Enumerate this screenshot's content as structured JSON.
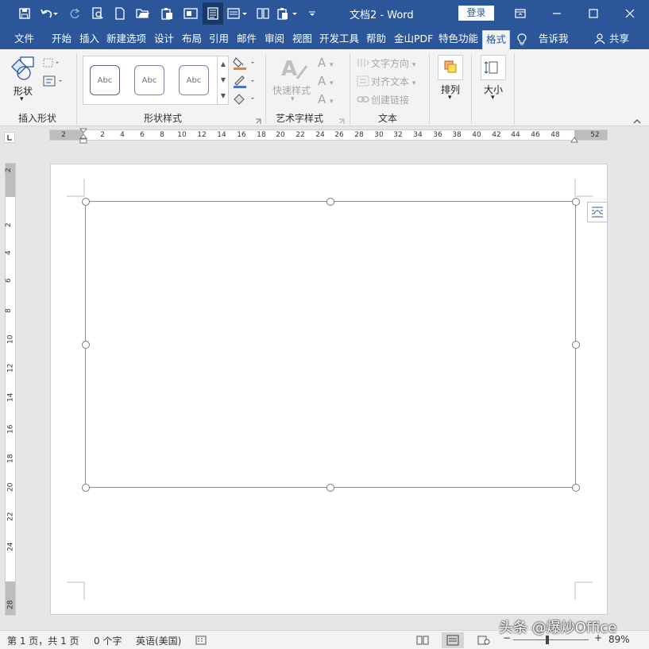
{
  "app": {
    "title": "文档2  -  Word",
    "login_label": "登录",
    "accent_color": "#2b579a"
  },
  "quick_access": {
    "icons": [
      "save-icon",
      "undo-icon",
      "redo-icon",
      "print-preview-icon",
      "new-document-icon",
      "open-folder-icon",
      "paste-icon",
      "screenshot-icon",
      "reading-view-icon",
      "page-layout-icon",
      "two-page-icon",
      "paste-special-icon",
      "customize-qat-icon"
    ]
  },
  "tabs": [
    "文件",
    "开始",
    "插入",
    "新建选项",
    "设计",
    "布局",
    "引用",
    "邮件",
    "审阅",
    "视图",
    "开发工具",
    "帮助",
    "金山PDF",
    "特色功能",
    "格式"
  ],
  "active_tab": "格式",
  "tell_me": "告诉我",
  "share": "共享",
  "ribbon": {
    "insert_shapes": {
      "label": "插入形状",
      "shape_btn": "形状"
    },
    "shape_styles": {
      "label": "形状样式",
      "style_text": "Abc"
    },
    "wordart": {
      "label": "艺术字样式",
      "quick_styles": "快速样式"
    },
    "text": {
      "label": "文本",
      "direction": "文字方向",
      "align": "对齐文本",
      "link": "创建链接"
    },
    "arrange": {
      "label": "排列"
    },
    "size": {
      "label": "大小"
    }
  },
  "ruler": {
    "h_ticks": [
      "2",
      "2",
      "4",
      "6",
      "8",
      "10",
      "12",
      "14",
      "16",
      "18",
      "20",
      "22",
      "24",
      "26",
      "28",
      "30",
      "32",
      "34",
      "36",
      "38",
      "40",
      "42",
      "44",
      "46",
      "48",
      "52"
    ],
    "v_ticks": [
      "2",
      "2",
      "4",
      "6",
      "8",
      "10",
      "12",
      "14",
      "16",
      "18",
      "20",
      "22",
      "24",
      "28"
    ]
  },
  "status": {
    "page": "第 1 页，共 1 页",
    "words": "0 个字",
    "language": "英语(美国)",
    "zoom": "89%"
  },
  "watermark": "头条 @爆炒Office"
}
